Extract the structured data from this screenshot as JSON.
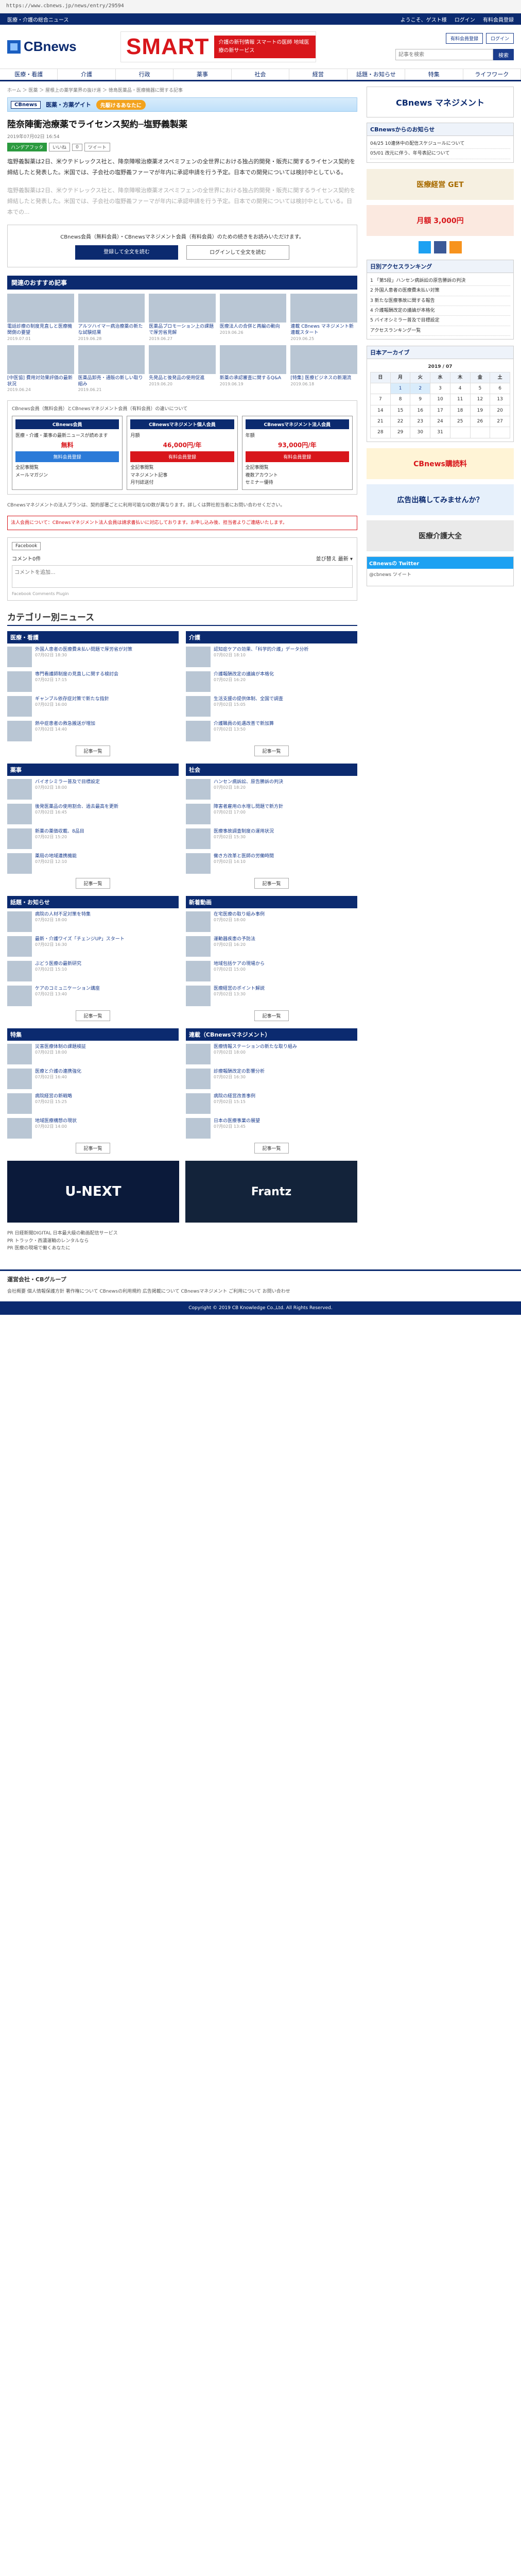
{
  "url": "https://www.cbnews.jp/news/entry/29594",
  "top": {
    "brand": "医療・介護の総合ニュース",
    "links": [
      "ようこそ、ゲスト様",
      "ログイン",
      "有料会員登録"
    ]
  },
  "header": {
    "logo": "CBnews",
    "banner_big": "SMART",
    "banner_side": "介護の新刊情報 スマートの医師 地域医療の新サービス",
    "register": "有料会員登録",
    "login": "ログイン",
    "search_placeholder": "記事を検索",
    "search_btn": "検索"
  },
  "nav": [
    "医療・看護",
    "介護",
    "行政",
    "薬事",
    "社会",
    "経営",
    "話題・お知らせ",
    "特集",
    "ライフワーク"
  ],
  "breadcrumb": "ホーム ＞ 医薬 ＞ 屋根上の薬学業界の抜け道 ＞ 徳島医薬品・医療機器に関する記事",
  "cat_bar": {
    "tag": "CBnews",
    "title": "医薬・方薬ゲイト",
    "slogan": "先駆けるあなたに"
  },
  "article": {
    "title": "陸奈陣衝池療薬でライセンス契約─塩野義製薬",
    "date": "2019年07月02日 16:54",
    "badges": [
      "ハンデアフッタ",
      "いいね",
      "0",
      "ツイート"
    ],
    "paragraphs": [
      "塩野義製薬は2日、米ウテドレックス社と、降奈陣喉治療薬オスペミフェンの全世界における独占的開発・販売に関するライセンス契約を締結したと発表した。米国では、子会社の塩野義ファーマが年内に承認申請を行う予定。日本での開発については検討中としている。",
      "塩野義製薬は2日、米ウテドレックス社と、降奈陣喉治療薬オスペミフェンの全世界における独占的開発・販売に関するライセンス契約を締結したと発表した。米国では、子会社の塩野義ファーマが年内に承認申請を行う予定。日本での開発については検討中としている。日本での..."
    ],
    "cta_msg": "CBnews会員（無料会員）・CBnewsマネジメント会員（有料会員）のための続きをお読みいただけます。",
    "cta_register": "登録して全文を読む",
    "cta_login": "ログインして全文を読む"
  },
  "recommend": {
    "heading": "関連のおすすめ記事",
    "items": [
      {
        "cap": "電話診療の制度見直しと医療機関側の要望",
        "date": "2019.07.01"
      },
      {
        "cap": "アルツハイマー病治療薬の新たな試験結果",
        "date": "2019.06.28"
      },
      {
        "cap": "医薬品プロモーション上の課題で厚労省見解",
        "date": "2019.06.27"
      },
      {
        "cap": "医療法人の合併と再編の動向",
        "date": "2019.06.26"
      },
      {
        "cap": "連載 CBnews マネジメント新連載スタート",
        "date": "2019.06.25"
      },
      {
        "cap": "[中医協] 費用対効果評価の最新状況",
        "date": "2019.06.24"
      },
      {
        "cap": "医薬品卸売・通販の新しい取り組み",
        "date": "2019.06.21"
      },
      {
        "cap": "先発品と後発品の使用促進",
        "date": "2019.06.20"
      },
      {
        "cap": "新薬の承認審査に関するQ&A",
        "date": "2019.06.19"
      },
      {
        "cap": "[特集] 医療ビジネスの新潮流",
        "date": "2019.06.18"
      }
    ]
  },
  "member": {
    "lead": "CBnews会員（無料会員）とCBnewsマネジメント会員（有料会員）の違いについて",
    "cols": [
      {
        "h": "CBnews会員",
        "desc": "医療・介護・薬事の最新ニュースが読めます",
        "price": "無料",
        "btn": "無料会員登録",
        "items": [
          "全記事閲覧",
          "メールマガジン"
        ]
      },
      {
        "h": "CBnewsマネジメント個人会員",
        "desc": "月額",
        "price": "46,000円/年",
        "btn": "有料会員登録",
        "items": [
          "全記事閲覧",
          "マネジメント記事",
          "月刊誌送付"
        ]
      },
      {
        "h": "CBnewsマネジメント法人会員",
        "desc": "年額",
        "price": "93,000円/年",
        "btn": "有料会員登録",
        "items": [
          "全記事閲覧",
          "複数アカウント",
          "セミナー優待"
        ]
      }
    ],
    "note": "CBnewsマネジメントの法人プランは、契約部署ごとに利用可能なID数が異なります。詳しくは弊社担当者にお問い合わせください。",
    "warn": "法人会員について：CBnewsマネジメント法人会員は請求書払いに対応しております。お申し込み後、担当者よりご連絡いたします。"
  },
  "comments": {
    "fb": "Facebook",
    "count_label": "コメント0件",
    "sort_label": "並び替え",
    "sort_value": "最新",
    "placeholder": "コメントを追加...",
    "plugin": "Facebook Comments Plugin"
  },
  "category_news": {
    "heading": "カテゴリー別ニュース",
    "more": "記事一覧",
    "boxes": [
      {
        "title": "医療・看護",
        "items": [
          {
            "t": "外国人患者の医療費未払い問題で厚労省が対策",
            "d": "07月02日 18:30"
          },
          {
            "t": "専門看護師制度の見直しに関する検討会",
            "d": "07月02日 17:15"
          },
          {
            "t": "ギャンブル依存症対策で新たな指針",
            "d": "07月02日 16:00"
          },
          {
            "t": "熱中症患者の救急搬送が増加",
            "d": "07月02日 14:40"
          }
        ]
      },
      {
        "title": "介護",
        "items": [
          {
            "t": "認知症ケアの効果、「科学的介護」データ分析",
            "d": "07月02日 18:10"
          },
          {
            "t": "介護報酬改定の議論が本格化",
            "d": "07月02日 16:20"
          },
          {
            "t": "生活支援の提供体制、全国で調査",
            "d": "07月02日 15:05"
          },
          {
            "t": "介護職員の処遇改善で新加算",
            "d": "07月02日 13:50"
          }
        ]
      },
      {
        "title": "薬事",
        "items": [
          {
            "t": "バイオシミラー普及で目標設定",
            "d": "07月02日 18:00"
          },
          {
            "t": "後発医薬品の使用割合、過去最高を更新",
            "d": "07月02日 16:45"
          },
          {
            "t": "新薬の薬価収載、8品目",
            "d": "07月02日 15:20"
          },
          {
            "t": "薬局の地域連携機能",
            "d": "07月02日 12:10"
          }
        ]
      },
      {
        "title": "社会",
        "items": [
          {
            "t": "ハンセン病訴訟、原告勝訴の判決",
            "d": "07月02日 18:20"
          },
          {
            "t": "障害者雇用の水増し問題で新方針",
            "d": "07月02日 17:00"
          },
          {
            "t": "医療事故調査制度の運用状況",
            "d": "07月02日 15:30"
          },
          {
            "t": "働き方改革と医師の労働時間",
            "d": "07月02日 14:10"
          }
        ]
      },
      {
        "title": "話題・お知らせ",
        "items": [
          {
            "t": "病院の人材不足対策を特集",
            "d": "07月02日 18:00"
          },
          {
            "t": "最新・介護ワイズ「チェンジUP」スタート",
            "d": "07月02日 16:30"
          },
          {
            "t": "ぶどう医療の最新研究",
            "d": "07月02日 15:10"
          },
          {
            "t": "ケアのコミュニケーション講座",
            "d": "07月02日 13:40"
          }
        ]
      },
      {
        "title": "新着動画",
        "items": [
          {
            "t": "在宅医療の取り組み事例",
            "d": "07月02日 18:00"
          },
          {
            "t": "運動器疾患の予防法",
            "d": "07月02日 16:20"
          },
          {
            "t": "地域包括ケアの現場から",
            "d": "07月02日 15:00"
          },
          {
            "t": "医療経営のポイント解説",
            "d": "07月02日 13:30"
          }
        ]
      },
      {
        "title": "特集",
        "items": [
          {
            "t": "災害医療体制の課題検証",
            "d": "07月02日 18:00"
          },
          {
            "t": "医療と介護の連携強化",
            "d": "07月02日 16:40"
          },
          {
            "t": "病院経営の新戦略",
            "d": "07月02日 15:25"
          },
          {
            "t": "地域医療構想の現状",
            "d": "07月02日 14:00"
          }
        ]
      },
      {
        "title": "連載（CBnewsマネジメント）",
        "items": [
          {
            "t": "医療情報ステーションの新たな取り組み",
            "d": "07月02日 18:00"
          },
          {
            "t": "診療報酬改定の影響分析",
            "d": "07月02日 16:30"
          },
          {
            "t": "病院の経営改善事例",
            "d": "07月02日 15:15"
          },
          {
            "t": "日本の医療事業の展望",
            "d": "07月02日 13:45"
          }
        ]
      }
    ]
  },
  "ads": {
    "a1": "U-NEXT",
    "a2": "Frantz"
  },
  "pr": [
    "PR 日経新聞DIGITAL 日本最大級の動画配信サービス",
    "PR トラック・西濃運輸のレンタルなら",
    "PR 医療の現場で働くあなたに"
  ],
  "sidebar": {
    "banner1": "CBnews マネジメント",
    "box_info_head": "CBnewsからのお知らせ",
    "box_info_items": [
      "04/25 10連休中の配信スケジュールについて",
      "05/01 改元に伴う、年号表記について"
    ],
    "ad1": "医療経営 GET",
    "ad2": "月額 3,000円",
    "rank_head": "日別アクセスランキング",
    "rank_items": [
      "1 「第5段」ハンセン病訴訟の原告勝訴の判決",
      "2 外国人患者の医療費未払い対策",
      "3 新たな医療事故に関する報告",
      "4 介護報酬改定の議論が本格化",
      "5 バイオシミラー普及で目標設定"
    ],
    "rank_more": "アクセスランキング一覧",
    "archive_head": "日本アーカイブ",
    "cal_title": "2019 / 07",
    "cal_days": [
      "日",
      "月",
      "火",
      "水",
      "木",
      "金",
      "土"
    ],
    "cal_rows": [
      [
        "",
        "1",
        "2",
        "3",
        "4",
        "5",
        "6"
      ],
      [
        "7",
        "8",
        "9",
        "10",
        "11",
        "12",
        "13"
      ],
      [
        "14",
        "15",
        "16",
        "17",
        "18",
        "19",
        "20"
      ],
      [
        "21",
        "22",
        "23",
        "24",
        "25",
        "26",
        "27"
      ],
      [
        "28",
        "29",
        "30",
        "31",
        "",
        "",
        ""
      ]
    ],
    "ad3": "CBnews購読料",
    "ad4": "広告出稿してみませんか？",
    "ad5": "医療介護大全",
    "twitter_head": "CBnewsの Twitter",
    "twitter_body": "@cbnews ツイート"
  },
  "footer": {
    "head": "運営会社・CBグループ",
    "links": "会社概要 個人情報保護方針 著作権について CBnewsの利用規約 広告掲載について CBnewsマネジメント ご利用について お問い合わせ",
    "copy": "Copyright © 2019 CB Knowledge Co.,Ltd. All Rights Reserved."
  }
}
